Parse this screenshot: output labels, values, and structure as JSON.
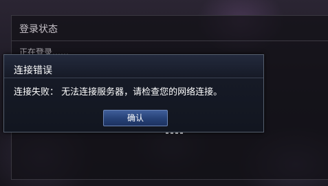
{
  "login_panel": {
    "title": "登录状态",
    "status": "正在登录……"
  },
  "error_dialog": {
    "title": "连接错误",
    "message": "连接失败： 无法连接服务器，请检查您的网络连接。",
    "confirm_label": "确认"
  },
  "colors": {
    "dialog_background": "#161a26",
    "dialog_border": "#56606f",
    "button_accent": "#284378"
  }
}
